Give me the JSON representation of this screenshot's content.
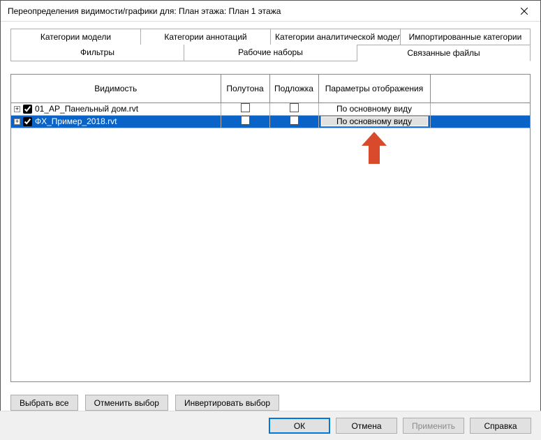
{
  "window": {
    "title": "Переопределения видимости/графики для: План этажа: План 1 этажа"
  },
  "tabs": {
    "row1": [
      "Категории модели",
      "Категории аннотаций",
      "Категории аналитической модели",
      "Импортированные категории"
    ],
    "row2": [
      "Фильтры",
      "Рабочие наборы",
      "Связанные файлы"
    ],
    "active": "Связанные файлы"
  },
  "grid": {
    "headers": {
      "visibility": "Видимость",
      "halftone": "Полутона",
      "underlay": "Подложка",
      "display_params": "Параметры отображения"
    },
    "rows": [
      {
        "name": "01_АР_Панельный дом.rvt",
        "checked": true,
        "display": "По основному виду",
        "selected": false
      },
      {
        "name": "ФХ_Пример_2018.rvt",
        "checked": true,
        "display": "По основному виду",
        "selected": true
      }
    ]
  },
  "selection_buttons": {
    "select_all": "Выбрать все",
    "select_none": "Отменить выбор",
    "invert": "Инвертировать выбор"
  },
  "dialog_buttons": {
    "ok": "ОК",
    "cancel": "Отмена",
    "apply": "Применить",
    "help": "Справка"
  }
}
